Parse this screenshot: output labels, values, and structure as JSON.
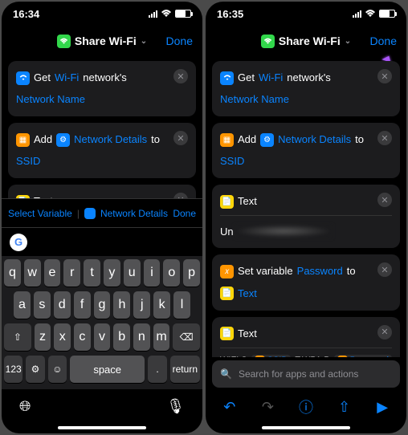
{
  "status": {
    "time": "16:34",
    "time2": "16:35"
  },
  "header": {
    "title": "Share Wi-Fi",
    "done": "Done"
  },
  "cards": {
    "get": {
      "pre": "Get",
      "wifi": "Wi-Fi",
      "post": "network's",
      "name": "Network Name"
    },
    "add": {
      "pre": "Add",
      "detail": "Network Details",
      "to": "to",
      "ssid": "SSID"
    },
    "text": {
      "title": "Text",
      "val": "Un"
    },
    "setvar": {
      "pre": "Set variable",
      "pwd": "Password",
      "to": "to",
      "txt": "Text"
    },
    "wifi_str": {
      "p1": "WIFI:S:",
      "t1": "SSID",
      "p2": ";T:WPA;P:",
      "t2": "Password",
      "p3": ";;"
    }
  },
  "kb_toolbar": {
    "select": "Select Variable",
    "nd": "Network Details",
    "done": "Done"
  },
  "keys_r1": [
    "q",
    "w",
    "e",
    "r",
    "t",
    "y",
    "u",
    "i",
    "o",
    "p"
  ],
  "keys_r2": [
    "a",
    "s",
    "d",
    "f",
    "g",
    "h",
    "j",
    "k",
    "l"
  ],
  "keys_r3": [
    "z",
    "x",
    "c",
    "v",
    "b",
    "n",
    "m"
  ],
  "keys_r4": {
    "num": "123",
    "space": "space",
    "ret": "return"
  },
  "search_ph": "Search for apps and actions"
}
